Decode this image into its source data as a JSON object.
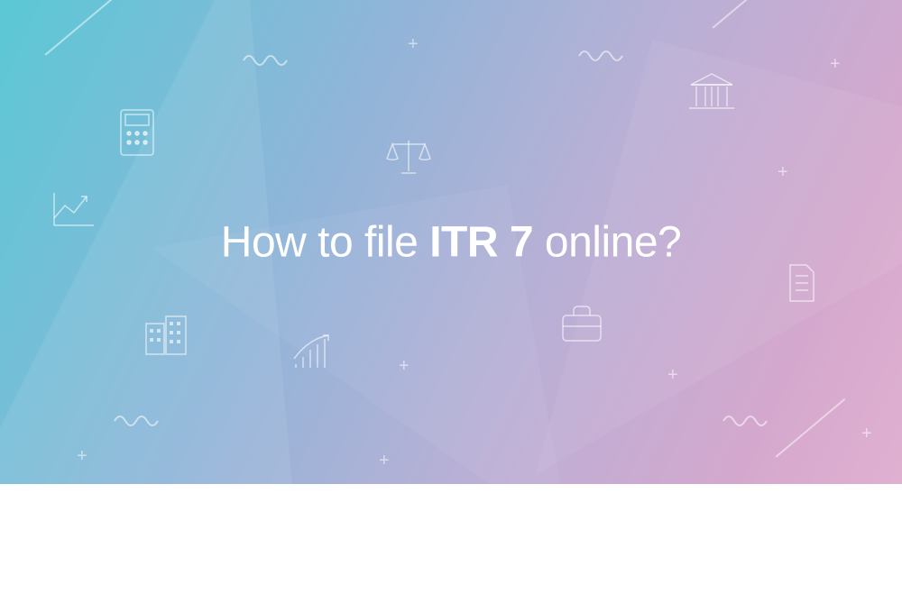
{
  "headline": {
    "part1": "How to file ",
    "bold": "ITR 7",
    "part2": " online?"
  }
}
